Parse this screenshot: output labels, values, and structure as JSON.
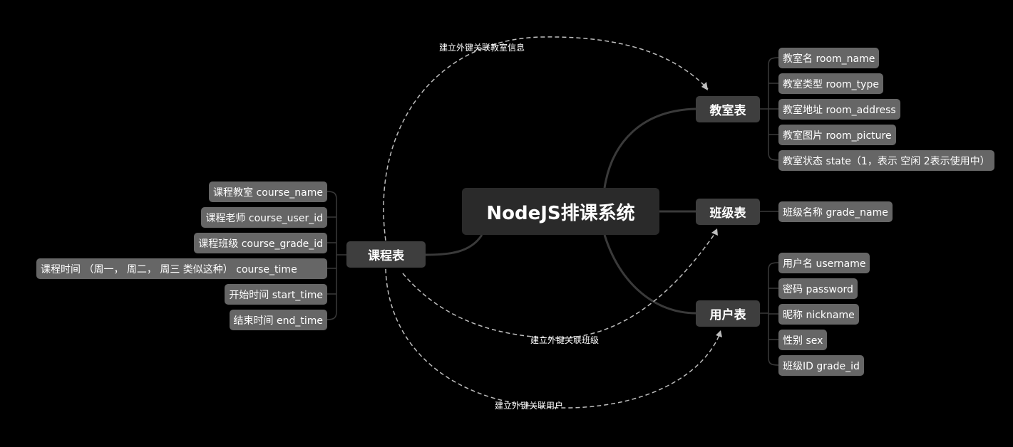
{
  "root": {
    "title": "NodeJS排课系统"
  },
  "branches": {
    "room": {
      "label": "教室表"
    },
    "grade": {
      "label": "班级表"
    },
    "user": {
      "label": "用户表"
    },
    "course": {
      "label": "课程表"
    }
  },
  "room_fields": [
    "教室名   room_name",
    "教室类型  room_type",
    "教室地址  room_address",
    "教室图片  room_picture",
    "教室状态  state（1，表示 空闲 2表示使用中）"
  ],
  "grade_fields": [
    "班级名称   grade_name"
  ],
  "user_fields": [
    "用户名   username",
    "密码   password",
    "昵称  nickname",
    "性别  sex",
    "班级ID   grade_id"
  ],
  "course_fields": [
    "课程教室 course_name",
    "课程老师  course_user_id",
    "课程班级  course_grade_id",
    "课程时间  （周一， 周二， 周三 类似这种） course_time",
    "开始时间  start_time",
    "结束时间  end_time"
  ],
  "relations": {
    "room": "建立外键关联教室信息",
    "grade": "建立外键关联班级",
    "user": "建立外键关联用户"
  },
  "colors": {
    "background": "#000000",
    "root": "#2a2a2a",
    "branch": "#3e3e3e",
    "leaf": "#666666",
    "connector": "#3a3a3a",
    "relation": "#bdbdbd"
  }
}
